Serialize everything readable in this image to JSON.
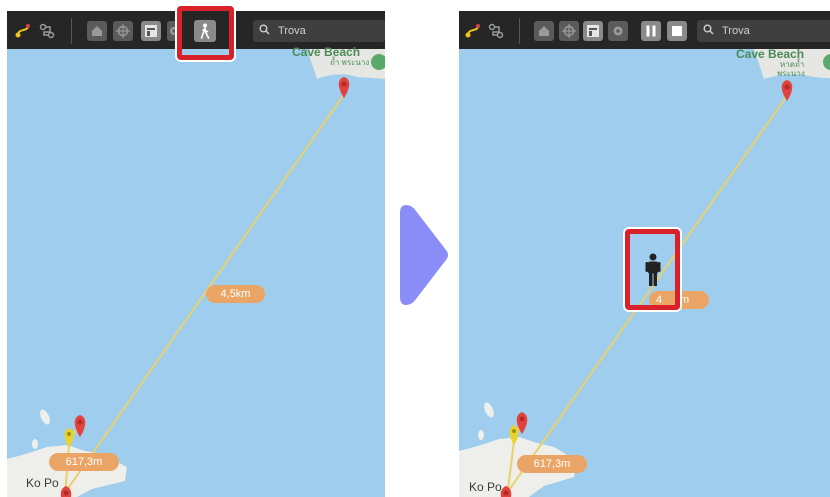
{
  "left_panel": {
    "search": {
      "placeholder": "Trova"
    },
    "place_label": "Ko Po",
    "beach_label": "Cave Beach",
    "beach_thai": "ถ้ำ พระนาง",
    "distances": {
      "main": "4,5km",
      "short": "617,3m"
    }
  },
  "right_panel": {
    "search": {
      "placeholder": "Trova"
    },
    "place_label": "Ko Po",
    "beach_label": "Cave Beach",
    "beach_thai_1": "หาดถ้ำ",
    "beach_thai_2": "พระนาง",
    "distances": {
      "main": "4",
      "main_tail": "m",
      "short": "617,3m"
    }
  },
  "colors": {
    "toolbar_bg": "#262626",
    "sea": "#9fcded",
    "route_line": "#e9d16e",
    "distance_pill": "#eaa566",
    "highlight_frame": "#d82128",
    "arrow": "#8a8cf8",
    "marker_red": "#e2423e",
    "marker_yellow": "#e7d232"
  },
  "icons": {
    "route_a": "route-pin-icon",
    "route_b": "route-outline-icon",
    "home": "home-icon",
    "crosshair": "crosshair-icon",
    "panel": "panel-icon",
    "gear": "gear-icon",
    "walk": "walking-person-icon",
    "pause": "pause-icon",
    "stop": "stop-icon",
    "search": "search-icon",
    "person": "person-marker-icon"
  }
}
